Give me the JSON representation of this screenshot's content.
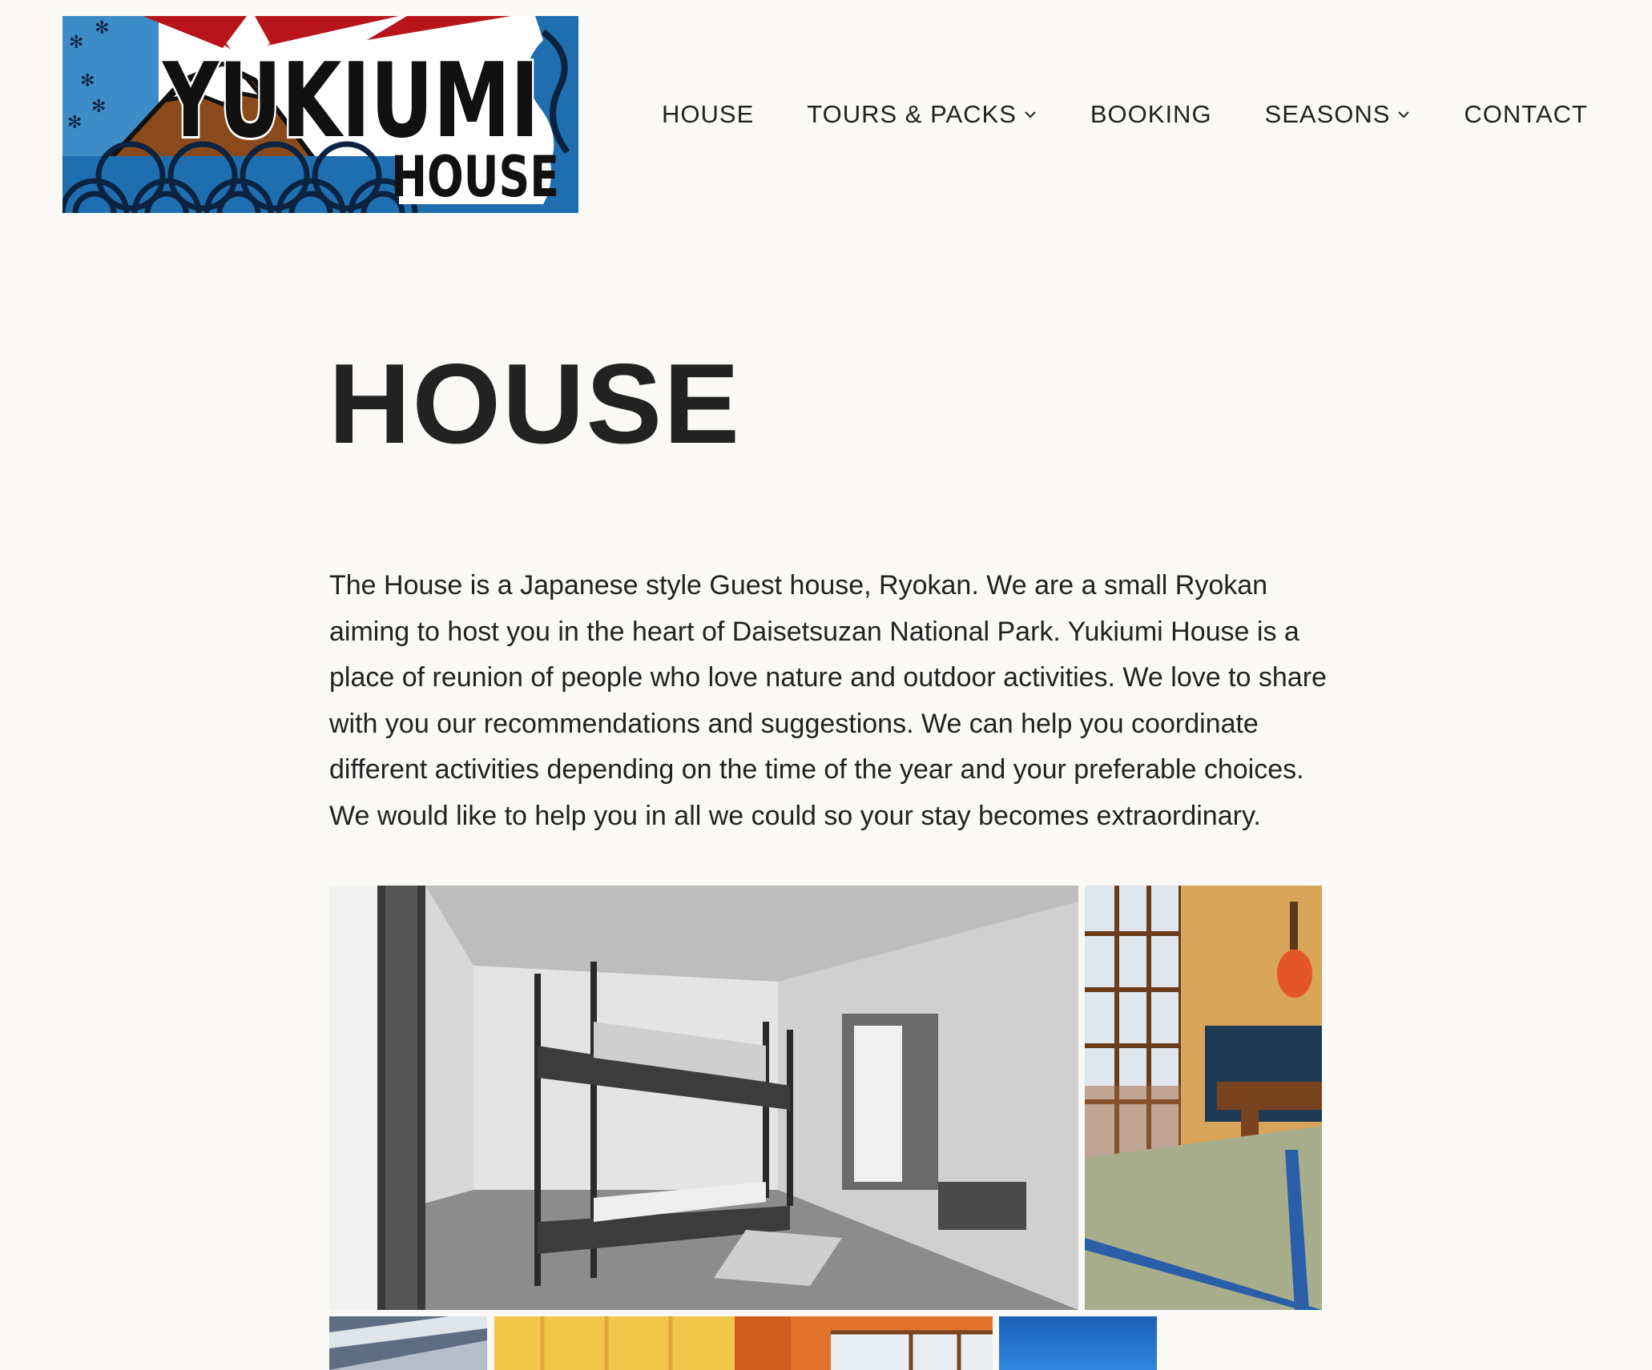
{
  "header": {
    "logo": {
      "line1": "YUKIUMI",
      "line2": "HOUSE"
    },
    "nav": [
      {
        "label": "HOUSE",
        "has_dropdown": false
      },
      {
        "label": "TOURS & PACKS",
        "has_dropdown": true
      },
      {
        "label": "BOOKING",
        "has_dropdown": false
      },
      {
        "label": "SEASONS",
        "has_dropdown": true
      },
      {
        "label": "CONTACT",
        "has_dropdown": false
      }
    ]
  },
  "main": {
    "title": "HOUSE",
    "intro": "The House is a Japanese style Guest house, Ryokan. We are a small Ryokan aiming to host you in the heart of Daisetsuzan National Park. Yukiumi House is a place of reunion of people who love nature and outdoor activities. We love to share with you our recommendations and suggestions. We can help you coordinate different activities depending on the time of the year and your preferable choices. We would like to help you in all we could so your stay becomes extraordinary.",
    "gallery": [
      {
        "subject": "bunk-bed-room-photo"
      },
      {
        "subject": "tatami-room-photo"
      },
      {
        "subject": "building-exterior-photo"
      },
      {
        "subject": "orange-curtain-room-photo"
      },
      {
        "subject": "blue-sky-photo"
      }
    ]
  },
  "colors": {
    "background": "#faf9f6",
    "text": "#222222",
    "logo_blue": "#1f6fb0",
    "logo_dark_blue": "#0f3f66",
    "logo_red": "#c0201c",
    "logo_brown": "#8a4a1c"
  }
}
